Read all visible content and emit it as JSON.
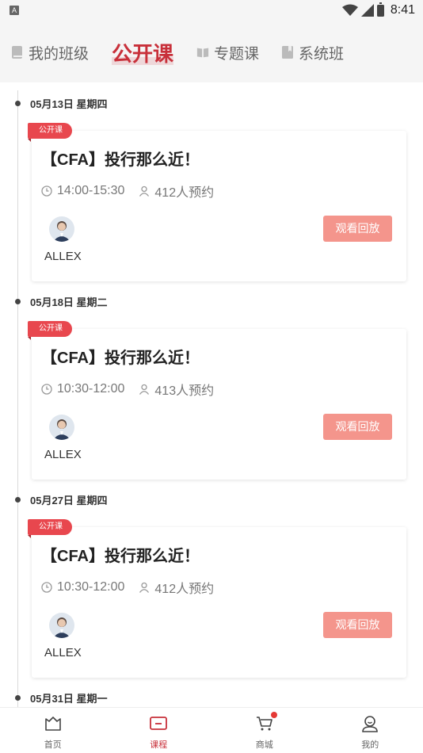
{
  "status_bar": {
    "app_icon_letter": "A",
    "time": "8:41"
  },
  "top_tabs": [
    {
      "label": "我的班级",
      "icon": "book-icon",
      "active": false
    },
    {
      "label": "公开课",
      "icon": "",
      "active": true
    },
    {
      "label": "专题课",
      "icon": "open-book-icon",
      "active": false
    },
    {
      "label": "系统班",
      "icon": "bookmark-icon",
      "active": false
    }
  ],
  "sessions": [
    {
      "date": "05月13日 星期四",
      "tag": "公开课",
      "title": "【CFA】投行那么近！",
      "time": "14:00-15:30",
      "reservations": "412人预约",
      "teacher": "ALLEX",
      "button": "观看回放"
    },
    {
      "date": "05月18日 星期二",
      "tag": "公开课",
      "title": "【CFA】投行那么近！",
      "time": "10:30-12:00",
      "reservations": "413人预约",
      "teacher": "ALLEX",
      "button": "观看回放"
    },
    {
      "date": "05月27日 星期四",
      "tag": "公开课",
      "title": "【CFA】投行那么近！",
      "time": "10:30-12:00",
      "reservations": "412人预约",
      "teacher": "ALLEX",
      "button": "观看回放"
    },
    {
      "date": "05月31日 星期一"
    }
  ],
  "bottom_nav": [
    {
      "label": "首页",
      "icon": "home-icon"
    },
    {
      "label": "课程",
      "icon": "course-icon",
      "active": true
    },
    {
      "label": "商城",
      "icon": "cart-icon",
      "badge": true
    },
    {
      "label": "我的",
      "icon": "profile-icon"
    }
  ],
  "colors": {
    "accent": "#c8303a",
    "tag": "#e8474e",
    "button": "#f4958c"
  }
}
